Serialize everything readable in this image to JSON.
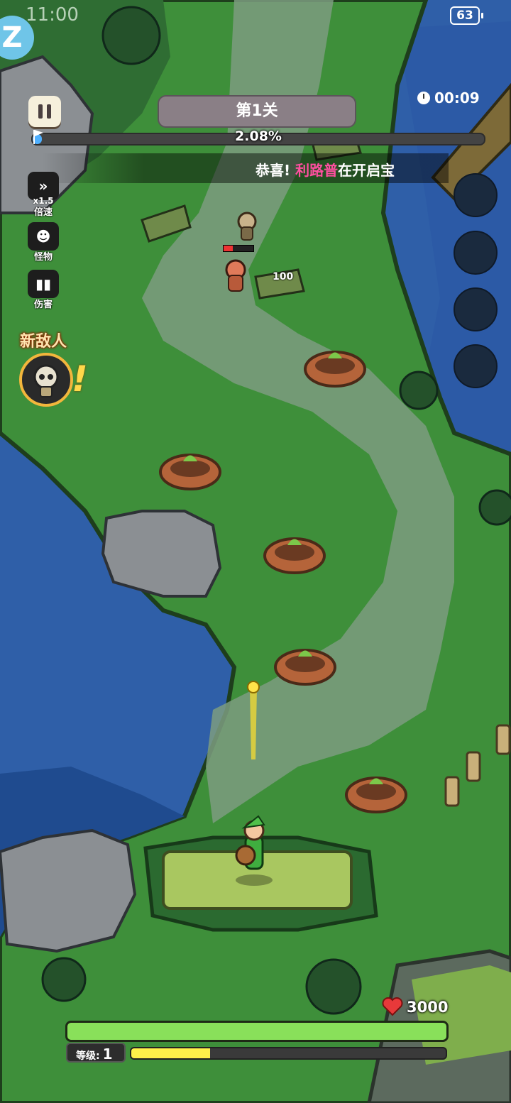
{
  "status_bar": {
    "time": "11:00",
    "battery": "63"
  },
  "hud": {
    "level_title": "第1关",
    "timer": "00:09",
    "progress_text": "2.08%",
    "progress_fraction": 0.0208
  },
  "banner": {
    "prefix": "恭喜! ",
    "player": "利路普",
    "suffix": "在开启宝"
  },
  "side_menu": {
    "speed_value": "x1.5",
    "speed_label": "倍速",
    "monster_label": "怪物",
    "damage_label": "伤害"
  },
  "new_enemy": {
    "title": "新敌人",
    "mark": "!"
  },
  "damage_popup": "100",
  "player": {
    "hp": "3000",
    "level_label": "等级:",
    "level": "1",
    "xp_fraction": 0.25
  },
  "colors": {
    "grass": "#3e8f3a",
    "path": "#7d9c80",
    "water": "#2f5fa8",
    "hp": "#89e05a",
    "xp": "#fff14a",
    "progress": "#4fb0ff"
  },
  "icons": [
    "pause-icon",
    "flag-icon",
    "clock-icon",
    "fast-forward-icon",
    "monster-icon",
    "bar-chart-icon",
    "heart-icon",
    "skull-icon"
  ]
}
